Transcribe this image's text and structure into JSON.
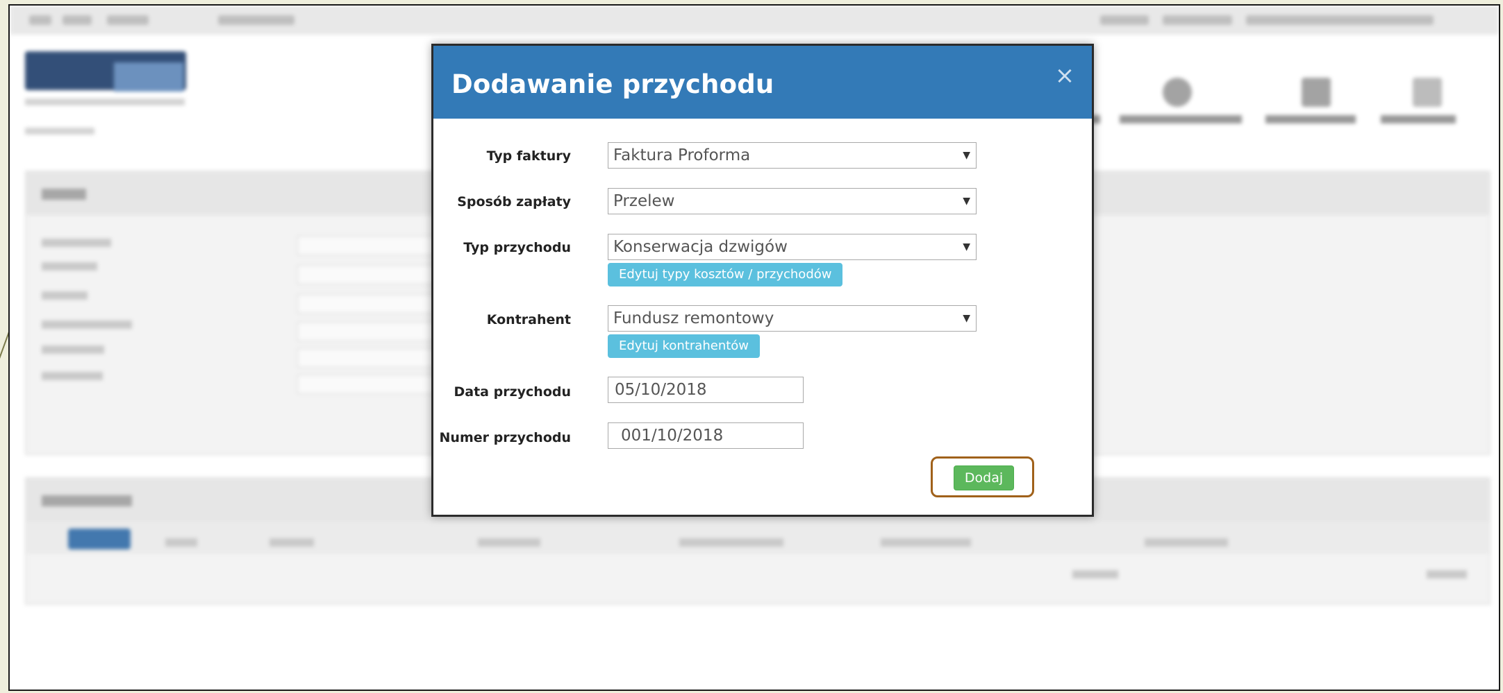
{
  "modal": {
    "title": "Dodawanie przychodu",
    "close_icon": "close-icon",
    "fields": {
      "typ_faktury": {
        "label": "Typ faktury",
        "value": "Faktura Proforma"
      },
      "sposob_zaplaty": {
        "label": "Sposób zapłaty",
        "value": "Przelew"
      },
      "typ_przychodu": {
        "label": "Typ przychodu",
        "value": "Konserwacja dzwigów",
        "edit_button": "Edytuj typy kosztów / przychodów"
      },
      "kontrahent": {
        "label": "Kontrahent",
        "value": "Fundusz remontowy",
        "edit_button": "Edytuj kontrahentów"
      },
      "data_przychodu": {
        "label": "Data przychodu",
        "value": "05/10/2018"
      },
      "numer_przychodu": {
        "label": "Numer przychodu",
        "value": "001/10/2018"
      }
    },
    "submit_label": "Dodaj"
  },
  "colors": {
    "header": "#337ab7",
    "info_button": "#5bc0de",
    "success_button": "#5cb85c",
    "highlight_border": "#a0611a"
  }
}
